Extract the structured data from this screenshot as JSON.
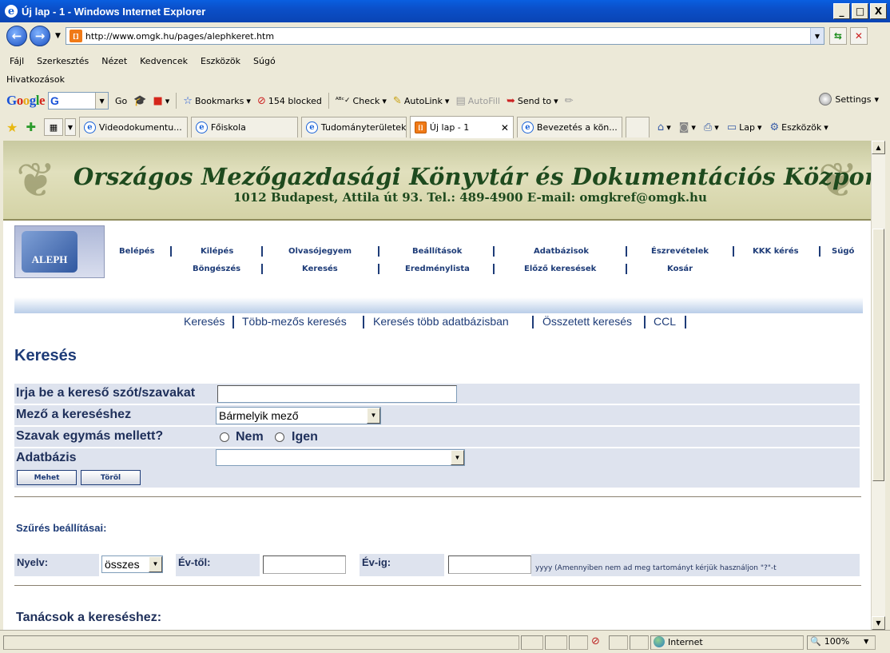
{
  "window": {
    "title": "Új lap - 1 - Windows Internet Explorer",
    "minimize": "_",
    "maximize": "□",
    "close": "X"
  },
  "address": {
    "url": "http://www.omgk.hu/pages/alephkeret.htm"
  },
  "menu": [
    "Fájl",
    "Szerkesztés",
    "Nézet",
    "Kedvencek",
    "Eszközök",
    "Súgó"
  ],
  "links_bar": "Hivatkozások",
  "google_toolbar": {
    "go": "Go",
    "bookmarks": "Bookmarks",
    "blocked": "154 blocked",
    "check": "Check",
    "autolink": "AutoLink",
    "autofill": "AutoFill",
    "send_to": "Send to",
    "settings": "Settings"
  },
  "tabs": [
    {
      "label": "Videodokumentu...",
      "active": false
    },
    {
      "label": "Főiskola",
      "active": false
    },
    {
      "label": "Tudományterületek",
      "active": false
    },
    {
      "label": "Új lap - 1",
      "active": true
    },
    {
      "label": "Bevezetés a kön...",
      "active": false
    }
  ],
  "command_bar": {
    "page": "Lap",
    "tools": "Eszközök"
  },
  "banner": {
    "title": "Országos Mezőgazdasági Könyvtár és Dokumentációs Központ",
    "subtitle": "1012 Budapest, Attila út 93. Tel.: 489-4900 E-mail: omgkref@omgk.hu"
  },
  "logo_text": "ALEPH",
  "nav_row1": [
    "Belépés",
    "Kilépés",
    "Olvasójegyem",
    "Beállítások",
    "Adatbázisok",
    "Észrevételek",
    "KKK kérés",
    "Súgó"
  ],
  "nav_row2": [
    "Böngészés",
    "Keresés",
    "Eredménylista",
    "Előző keresések",
    "Kosár"
  ],
  "search_tabs": [
    "Keresés",
    "Több-mezős keresés",
    "Keresés több adatbázisban",
    "Összetett keresés",
    "CCL"
  ],
  "search_form": {
    "title": "Keresés",
    "term_label": "Irja be a kereső szót/szavakat",
    "term_value": "",
    "field_label": "Mező a kereséshez",
    "field_value": "Bármelyik mező",
    "adjacent_label": "Szavak egymás mellett?",
    "adjacent_no": "Nem",
    "adjacent_yes": "Igen",
    "db_label": "Adatbázis",
    "db_value": "",
    "go_button": "Mehet",
    "clear_button": "Töröl"
  },
  "filter": {
    "title": "Szűrés beállításai:",
    "lang_label": "Nyelv:",
    "lang_value": "összes",
    "from_label": "Év-től:",
    "to_label": "Év-ig:",
    "hint": "yyyy (Amennyiben nem ad meg tartományt kérjük használjon \"?\"-t"
  },
  "tips_title": "Tanácsok a kereséshez:",
  "status": {
    "zone": "Internet",
    "zoom": "100%"
  }
}
